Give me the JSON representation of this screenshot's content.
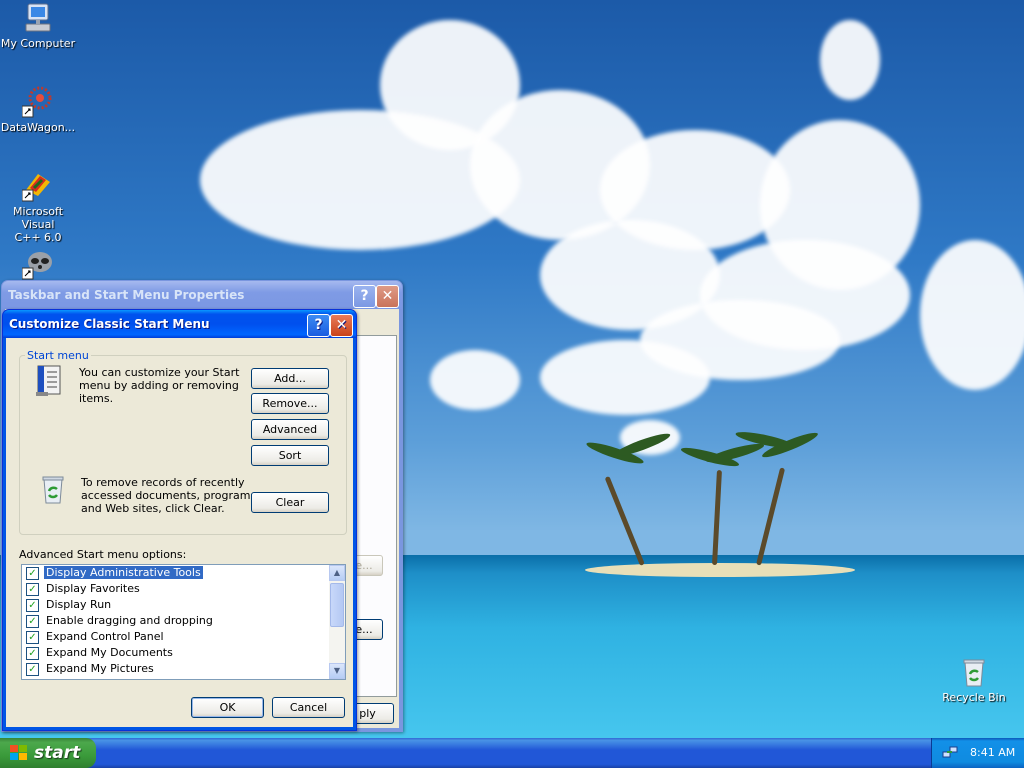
{
  "desktop": {
    "icons": [
      {
        "label": "My Computer"
      },
      {
        "label": "DataWagon..."
      },
      {
        "label_line1": "Microsoft Visual",
        "label_line2": "C++ 6.0"
      },
      {
        "label": "Recycle Bin"
      }
    ]
  },
  "taskbar_props_window": {
    "title": "Taskbar and Start Menu Properties",
    "help_glyph": "?",
    "close_glyph": "✕",
    "partial_button_1": "e...",
    "partial_button_2": "e...",
    "partial_apply": "ply"
  },
  "customize_window": {
    "title": "Customize Classic Start Menu",
    "help_glyph": "?",
    "close_glyph": "✕",
    "start_menu_group": {
      "label": "Start menu",
      "customize_text_line1": "You can customize your Start",
      "customize_text_line2": "menu by adding or removing",
      "customize_text_line3": "items.",
      "remove_text_line1": "To remove records of recently",
      "remove_text_line2": "accessed documents, programs,",
      "remove_text_line3": "and Web sites, click Clear.",
      "add_button": "Add...",
      "remove_button": "Remove...",
      "advanced_button": "Advanced",
      "sort_button": "Sort",
      "clear_button": "Clear"
    },
    "advanced_label": "Advanced Start menu options:",
    "options": [
      {
        "label": "Display Administrative Tools",
        "checked": true,
        "selected": true
      },
      {
        "label": "Display Favorites",
        "checked": true
      },
      {
        "label": "Display Run",
        "checked": true
      },
      {
        "label": "Enable dragging and dropping",
        "checked": true
      },
      {
        "label": "Expand Control Panel",
        "checked": true
      },
      {
        "label": "Expand My Documents",
        "checked": true
      },
      {
        "label": "Expand My Pictures",
        "checked": true
      }
    ],
    "ok_button": "OK",
    "cancel_button": "Cancel"
  },
  "taskbar": {
    "start_label": "start",
    "clock": "8:41 AM"
  },
  "colors": {
    "xp_title_blue": "#0055e5",
    "dialog_face": "#ece9d8",
    "selection": "#316ac5",
    "start_green": "#3a9a3a"
  }
}
